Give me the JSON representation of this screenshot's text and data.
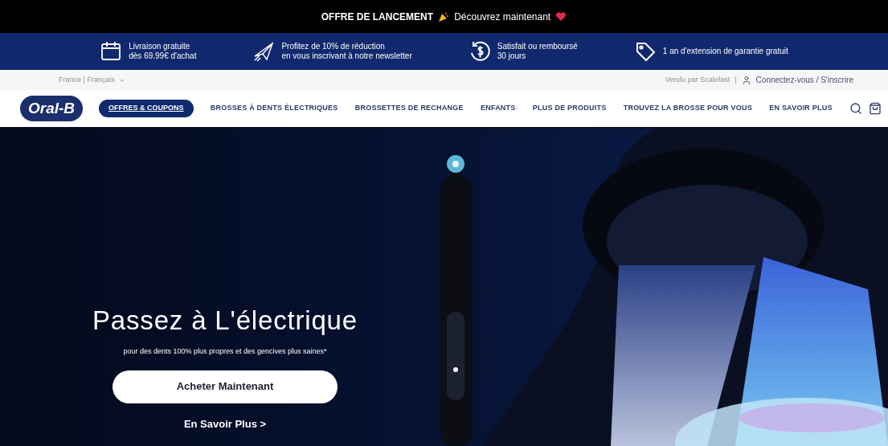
{
  "announcement": {
    "label": "OFFRE DE LANCEMENT",
    "action": "Découvrez maintenant"
  },
  "benefits": [
    {
      "kind": "calendar",
      "lines": [
        "Livraison gratuite",
        "dès 69.99€ d'achat"
      ]
    },
    {
      "kind": "plane",
      "lines": [
        "Profitez de 10% de réduction",
        "en vous inscrivant à notre newsletter"
      ]
    },
    {
      "kind": "money",
      "lines": [
        "Satisfait ou remboursé",
        "30 jours"
      ]
    },
    {
      "kind": "tag",
      "lines": [
        "1 an d'extension de garantie gratuit"
      ]
    }
  ],
  "utility_bar": {
    "locale": "France | Français",
    "seller": "Vendu par Scalefast",
    "separator": "|",
    "account": "Connectez-vous / S'inscrire"
  },
  "nav": {
    "logo": "Oral-B",
    "items": [
      {
        "label": "OFFRES & COUPONS",
        "kind": "promo"
      },
      {
        "label": "BROSSES À DENTS ÉLECTRIQUES",
        "kind": "link"
      },
      {
        "label": "BROSSETTES DE RECHANGE",
        "kind": "link"
      },
      {
        "label": "ENFANTS",
        "kind": "link"
      },
      {
        "label": "PLUS DE PRODUITS",
        "kind": "link"
      },
      {
        "label": "TROUVEZ LA BROSSE POUR VOUS",
        "kind": "link"
      },
      {
        "label": "EN SAVOIR PLUS",
        "kind": "link"
      }
    ]
  },
  "hero": {
    "title": "Passez à L'électrique",
    "subtitle": "pour des dents 100% plus propres et des gencives plus saines*",
    "primary_button": "Acheter Maintenant",
    "secondary_link": "En Savoir Plus >"
  }
}
